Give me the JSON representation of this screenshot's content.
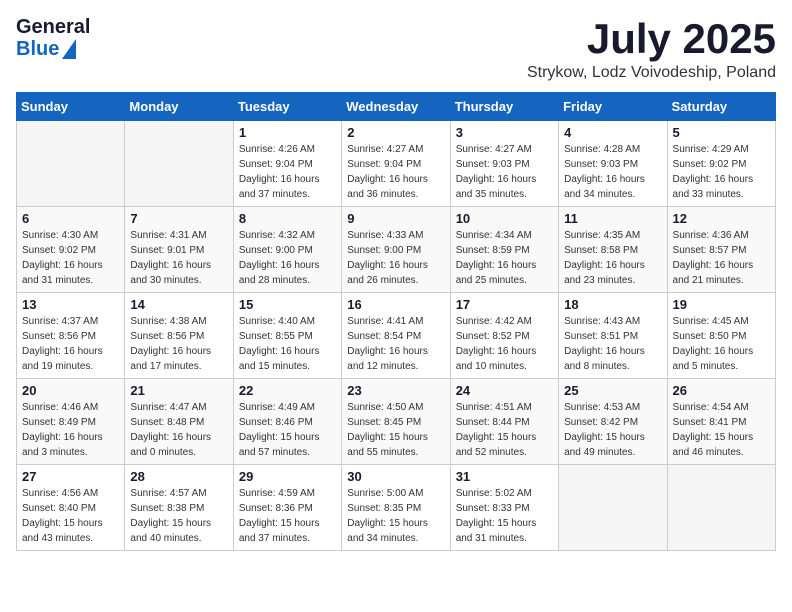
{
  "header": {
    "logo_general": "General",
    "logo_blue": "Blue",
    "month_title": "July 2025",
    "subtitle": "Strykow, Lodz Voivodeship, Poland"
  },
  "weekdays": [
    "Sunday",
    "Monday",
    "Tuesday",
    "Wednesday",
    "Thursday",
    "Friday",
    "Saturday"
  ],
  "weeks": [
    [
      {
        "day": "",
        "detail": ""
      },
      {
        "day": "",
        "detail": ""
      },
      {
        "day": "1",
        "detail": "Sunrise: 4:26 AM\nSunset: 9:04 PM\nDaylight: 16 hours\nand 37 minutes."
      },
      {
        "day": "2",
        "detail": "Sunrise: 4:27 AM\nSunset: 9:04 PM\nDaylight: 16 hours\nand 36 minutes."
      },
      {
        "day": "3",
        "detail": "Sunrise: 4:27 AM\nSunset: 9:03 PM\nDaylight: 16 hours\nand 35 minutes."
      },
      {
        "day": "4",
        "detail": "Sunrise: 4:28 AM\nSunset: 9:03 PM\nDaylight: 16 hours\nand 34 minutes."
      },
      {
        "day": "5",
        "detail": "Sunrise: 4:29 AM\nSunset: 9:02 PM\nDaylight: 16 hours\nand 33 minutes."
      }
    ],
    [
      {
        "day": "6",
        "detail": "Sunrise: 4:30 AM\nSunset: 9:02 PM\nDaylight: 16 hours\nand 31 minutes."
      },
      {
        "day": "7",
        "detail": "Sunrise: 4:31 AM\nSunset: 9:01 PM\nDaylight: 16 hours\nand 30 minutes."
      },
      {
        "day": "8",
        "detail": "Sunrise: 4:32 AM\nSunset: 9:00 PM\nDaylight: 16 hours\nand 28 minutes."
      },
      {
        "day": "9",
        "detail": "Sunrise: 4:33 AM\nSunset: 9:00 PM\nDaylight: 16 hours\nand 26 minutes."
      },
      {
        "day": "10",
        "detail": "Sunrise: 4:34 AM\nSunset: 8:59 PM\nDaylight: 16 hours\nand 25 minutes."
      },
      {
        "day": "11",
        "detail": "Sunrise: 4:35 AM\nSunset: 8:58 PM\nDaylight: 16 hours\nand 23 minutes."
      },
      {
        "day": "12",
        "detail": "Sunrise: 4:36 AM\nSunset: 8:57 PM\nDaylight: 16 hours\nand 21 minutes."
      }
    ],
    [
      {
        "day": "13",
        "detail": "Sunrise: 4:37 AM\nSunset: 8:56 PM\nDaylight: 16 hours\nand 19 minutes."
      },
      {
        "day": "14",
        "detail": "Sunrise: 4:38 AM\nSunset: 8:56 PM\nDaylight: 16 hours\nand 17 minutes."
      },
      {
        "day": "15",
        "detail": "Sunrise: 4:40 AM\nSunset: 8:55 PM\nDaylight: 16 hours\nand 15 minutes."
      },
      {
        "day": "16",
        "detail": "Sunrise: 4:41 AM\nSunset: 8:54 PM\nDaylight: 16 hours\nand 12 minutes."
      },
      {
        "day": "17",
        "detail": "Sunrise: 4:42 AM\nSunset: 8:52 PM\nDaylight: 16 hours\nand 10 minutes."
      },
      {
        "day": "18",
        "detail": "Sunrise: 4:43 AM\nSunset: 8:51 PM\nDaylight: 16 hours\nand 8 minutes."
      },
      {
        "day": "19",
        "detail": "Sunrise: 4:45 AM\nSunset: 8:50 PM\nDaylight: 16 hours\nand 5 minutes."
      }
    ],
    [
      {
        "day": "20",
        "detail": "Sunrise: 4:46 AM\nSunset: 8:49 PM\nDaylight: 16 hours\nand 3 minutes."
      },
      {
        "day": "21",
        "detail": "Sunrise: 4:47 AM\nSunset: 8:48 PM\nDaylight: 16 hours\nand 0 minutes."
      },
      {
        "day": "22",
        "detail": "Sunrise: 4:49 AM\nSunset: 8:46 PM\nDaylight: 15 hours\nand 57 minutes."
      },
      {
        "day": "23",
        "detail": "Sunrise: 4:50 AM\nSunset: 8:45 PM\nDaylight: 15 hours\nand 55 minutes."
      },
      {
        "day": "24",
        "detail": "Sunrise: 4:51 AM\nSunset: 8:44 PM\nDaylight: 15 hours\nand 52 minutes."
      },
      {
        "day": "25",
        "detail": "Sunrise: 4:53 AM\nSunset: 8:42 PM\nDaylight: 15 hours\nand 49 minutes."
      },
      {
        "day": "26",
        "detail": "Sunrise: 4:54 AM\nSunset: 8:41 PM\nDaylight: 15 hours\nand 46 minutes."
      }
    ],
    [
      {
        "day": "27",
        "detail": "Sunrise: 4:56 AM\nSunset: 8:40 PM\nDaylight: 15 hours\nand 43 minutes."
      },
      {
        "day": "28",
        "detail": "Sunrise: 4:57 AM\nSunset: 8:38 PM\nDaylight: 15 hours\nand 40 minutes."
      },
      {
        "day": "29",
        "detail": "Sunrise: 4:59 AM\nSunset: 8:36 PM\nDaylight: 15 hours\nand 37 minutes."
      },
      {
        "day": "30",
        "detail": "Sunrise: 5:00 AM\nSunset: 8:35 PM\nDaylight: 15 hours\nand 34 minutes."
      },
      {
        "day": "31",
        "detail": "Sunrise: 5:02 AM\nSunset: 8:33 PM\nDaylight: 15 hours\nand 31 minutes."
      },
      {
        "day": "",
        "detail": ""
      },
      {
        "day": "",
        "detail": ""
      }
    ]
  ]
}
